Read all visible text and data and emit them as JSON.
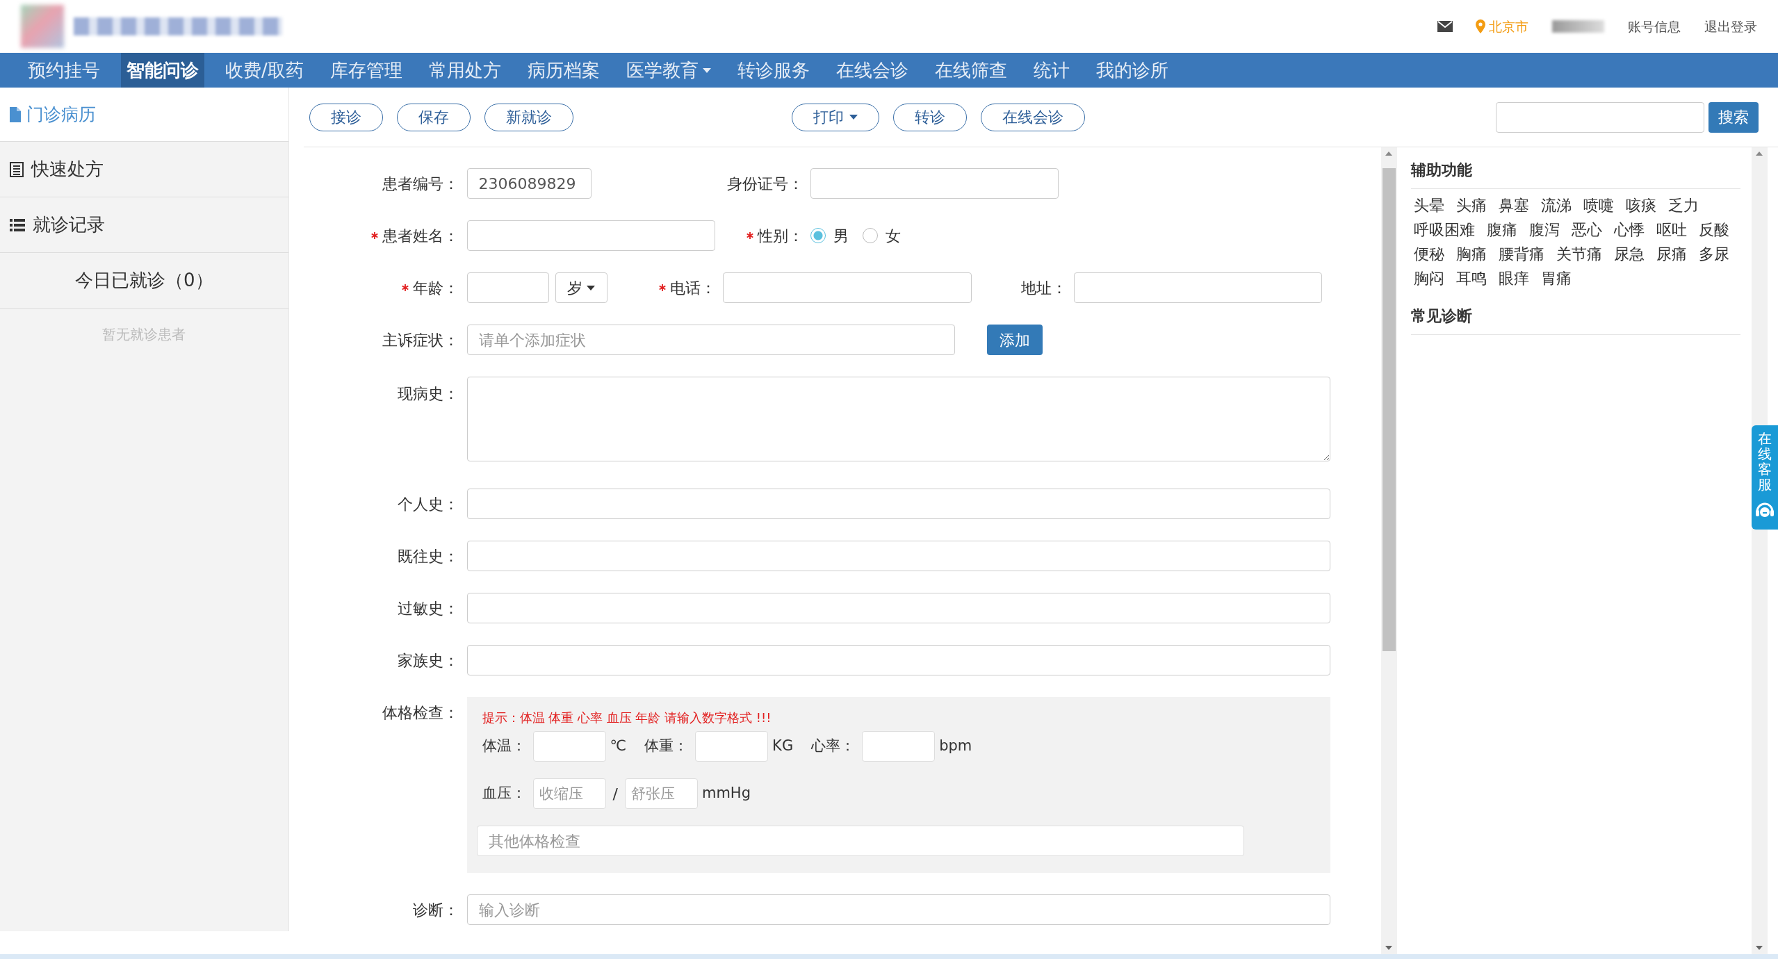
{
  "header": {
    "location": "北京市",
    "links": [
      "账号信息",
      "退出登录"
    ]
  },
  "nav": [
    {
      "label": "预约挂号",
      "selected": false,
      "dropdown": false
    },
    {
      "label": "智能问诊",
      "selected": true,
      "dropdown": false
    },
    {
      "label": "收费/取药",
      "selected": false,
      "dropdown": false
    },
    {
      "label": "库存管理",
      "selected": false,
      "dropdown": false
    },
    {
      "label": "常用处方",
      "selected": false,
      "dropdown": false
    },
    {
      "label": "病历档案",
      "selected": false,
      "dropdown": false
    },
    {
      "label": "医学教育",
      "selected": false,
      "dropdown": true
    },
    {
      "label": "转诊服务",
      "selected": false,
      "dropdown": false
    },
    {
      "label": "在线会诊",
      "selected": false,
      "dropdown": false
    },
    {
      "label": "在线筛查",
      "selected": false,
      "dropdown": false
    },
    {
      "label": "统计",
      "selected": false,
      "dropdown": false
    },
    {
      "label": "我的诊所",
      "selected": false,
      "dropdown": false
    }
  ],
  "sidebar": {
    "title": "门诊病历",
    "items": [
      {
        "label": "快速处方",
        "kind": "sheet"
      },
      {
        "label": "就诊记录",
        "kind": "list"
      }
    ],
    "today": "今日已就诊（0）",
    "empty": "暂无就诊患者"
  },
  "toolbar": {
    "left_buttons": [
      {
        "label": "接诊",
        "dropdown": false
      },
      {
        "label": "保存",
        "dropdown": false
      },
      {
        "label": "新就诊",
        "dropdown": false
      }
    ],
    "right_buttons": [
      {
        "label": "打印",
        "dropdown": true
      },
      {
        "label": "转诊",
        "dropdown": false
      },
      {
        "label": "在线会诊",
        "dropdown": false
      }
    ],
    "search_button": "搜索"
  },
  "form": {
    "patient_id": {
      "label": "患者编号：",
      "required": false,
      "value": "2306089829"
    },
    "id_card": {
      "label": "身份证号：",
      "required": false
    },
    "name": {
      "label": "患者姓名：",
      "required": true
    },
    "gender": {
      "label": "性别：",
      "required": true,
      "options": [
        {
          "label": "男",
          "selected": true
        },
        {
          "label": "女",
          "selected": false
        }
      ]
    },
    "age": {
      "label": "年龄：",
      "required": true,
      "unit": "岁"
    },
    "phone": {
      "label": "电话：",
      "required": true
    },
    "address": {
      "label": "地址：",
      "required": false
    },
    "complaint": {
      "label": "主诉症状：",
      "placeholder": "请单个添加症状",
      "button": "添加"
    },
    "histories": [
      {
        "label": "现病史：",
        "kind": "textarea"
      },
      {
        "label": "个人史：",
        "kind": "input"
      },
      {
        "label": "既往史：",
        "kind": "input"
      },
      {
        "label": "过敏史：",
        "kind": "input"
      },
      {
        "label": "家族史：",
        "kind": "input"
      }
    ],
    "exam": {
      "label": "体格检查：",
      "hint": "提示：体温 体重 心率 血压 年龄 请输入数字格式 !!!",
      "vitals": [
        {
          "label": "体温：",
          "unit": "℃"
        },
        {
          "label": "体重：",
          "unit": "KG"
        },
        {
          "label": "心率：",
          "unit": "bpm"
        }
      ],
      "bp": {
        "label": "血压：",
        "systolic": {
          "placeholder": "收缩压"
        },
        "separator": "/",
        "diastolic": {
          "placeholder": "舒张压"
        },
        "unit": "mmHg"
      },
      "other_placeholder": "其他体格检查"
    },
    "diagnosis": {
      "label": "诊断：",
      "placeholder": "输入诊断"
    }
  },
  "assist": {
    "title": "辅助功能",
    "symptoms": [
      "头晕",
      "头痛",
      "鼻塞",
      "流涕",
      "喷嚏",
      "咳痰",
      "乏力",
      "呼吸困难",
      "腹痛",
      "腹泻",
      "恶心",
      "心悸",
      "呕吐",
      "反酸",
      "便秘",
      "胸痛",
      "腰背痛",
      "关节痛",
      "尿急",
      "尿痛",
      "多尿",
      "胸闷",
      "耳鸣",
      "眼痒",
      "胃痛"
    ],
    "diagnosis_title": "常见诊断"
  },
  "service_tab": {
    "label": "在线客服"
  }
}
